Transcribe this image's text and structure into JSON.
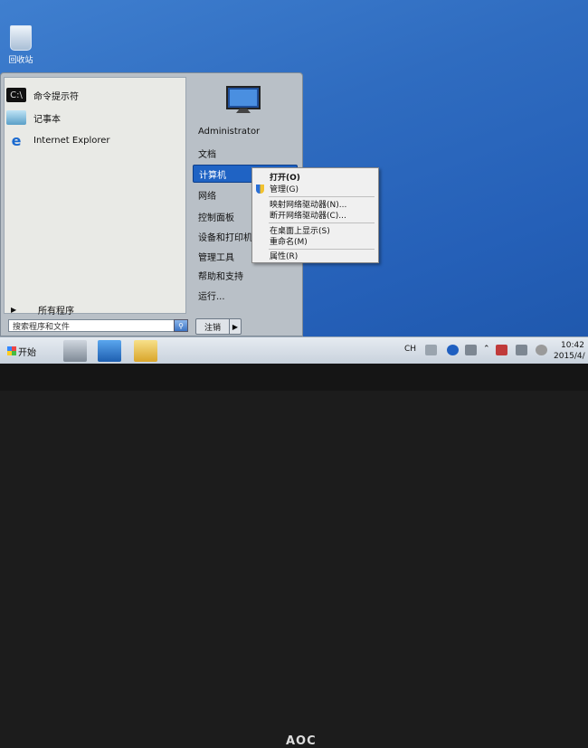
{
  "desktop": {
    "recycle_bin_label": "回收站"
  },
  "start_menu": {
    "programs": [
      {
        "label": "命令提示符",
        "icon": "cmd-icon"
      },
      {
        "label": "记事本",
        "icon": "notepad-icon"
      },
      {
        "label": "Internet Explorer",
        "icon": "ie-icon"
      }
    ],
    "all_programs": "所有程序",
    "search_placeholder": "搜索程序和文件",
    "right_items": {
      "user": "Administrator",
      "documents": "文档",
      "computer": "计算机",
      "network": "网络",
      "control_panel": "控制面板",
      "devices_printers": "设备和打印机",
      "admin_tools": "管理工具",
      "help": "帮助和支持",
      "run": "运行..."
    },
    "shutdown_label": "注销"
  },
  "context_menu": {
    "open": "打开(O)",
    "manage": "管理(G)",
    "map_drive": "映射网络驱动器(N)...",
    "disconnect_drive": "断开网络驱动器(C)...",
    "show_on_desktop": "在桌面上显示(S)",
    "rename": "重命名(M)",
    "properties": "属性(R)"
  },
  "taskbar": {
    "start_label": "开始",
    "lang": "CH",
    "clock_time": "10:42",
    "clock_date": "2015/4/"
  },
  "monitor": {
    "brand": "AOC"
  },
  "colors": {
    "accent": "#1f63c4",
    "desktop": "#2f6cc0"
  }
}
